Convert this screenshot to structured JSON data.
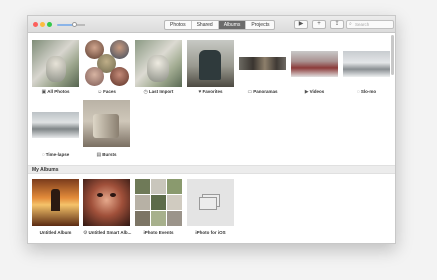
{
  "toolbar": {
    "tabs": [
      {
        "label": "Photos",
        "active": false
      },
      {
        "label": "Shared",
        "active": false
      },
      {
        "label": "Albums",
        "active": true
      },
      {
        "label": "Projects",
        "active": false
      }
    ],
    "play_icon": "play-icon",
    "add_icon": "plus-icon",
    "share_icon": "share-icon",
    "search_placeholder": "Search",
    "search_icon": "magnifier-icon"
  },
  "albums": [
    {
      "label": "All Photos",
      "icon": "photos-icon",
      "glyph": "▣"
    },
    {
      "label": "Faces",
      "icon": "face-icon",
      "glyph": "☺"
    },
    {
      "label": "Last Import",
      "icon": "clock-icon",
      "glyph": "◷"
    },
    {
      "label": "Favorites",
      "icon": "heart-icon",
      "glyph": "♥"
    },
    {
      "label": "Panoramas",
      "icon": "panorama-icon",
      "glyph": "▭"
    },
    {
      "label": "Videos",
      "icon": "video-icon",
      "glyph": "▶"
    },
    {
      "label": "Slo-mo",
      "icon": "slomo-icon",
      "glyph": "◌"
    },
    {
      "label": "Time-lapse",
      "icon": "timelapse-icon",
      "glyph": "◌"
    },
    {
      "label": "Bursts",
      "icon": "bursts-icon",
      "glyph": "▤"
    }
  ],
  "my_albums": {
    "title": "My Albums",
    "items": [
      {
        "label": "Untitled Album",
        "glyph": ""
      },
      {
        "label": "Untitled Smart Alb...",
        "glyph": "⚙"
      },
      {
        "label": "iPhoto Events",
        "glyph": ""
      },
      {
        "label": "iPhoto for iOS",
        "glyph": ""
      }
    ]
  }
}
